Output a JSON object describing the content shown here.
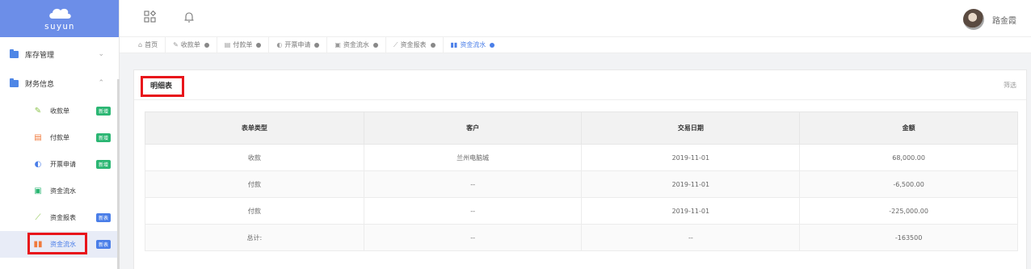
{
  "brand": "suyun",
  "sidebar": {
    "groups": [
      {
        "label": "库存管理",
        "expanded": false
      },
      {
        "label": "财务信息",
        "expanded": true
      }
    ],
    "items": [
      {
        "label": "收款单",
        "badge": "新增",
        "icon": "receipt-icon"
      },
      {
        "label": "付款单",
        "badge": "新增",
        "icon": "payment-icon"
      },
      {
        "label": "开票申请",
        "badge": "新增",
        "icon": "invoice-icon"
      },
      {
        "label": "资金流水",
        "badge": "",
        "icon": "cashflow-icon"
      },
      {
        "label": "资金报表",
        "badge": "新表",
        "icon": "line-chart-icon"
      },
      {
        "label": "资金流水",
        "badge": "新表",
        "icon": "bar-chart-icon"
      }
    ]
  },
  "user": {
    "name": "路金霞"
  },
  "tabs": [
    {
      "label": "首页",
      "icon": "home-icon"
    },
    {
      "label": "收款单",
      "icon": "receipt-icon"
    },
    {
      "label": "付款单",
      "icon": "payment-icon"
    },
    {
      "label": "开票申请",
      "icon": "invoice-icon"
    },
    {
      "label": "资金流水",
      "icon": "cashflow-icon"
    },
    {
      "label": "资金报表",
      "icon": "line-chart-icon"
    },
    {
      "label": "资金流水",
      "icon": "bar-chart-icon",
      "active": true
    }
  ],
  "card": {
    "title": "明细表",
    "filter": "筛选",
    "columns": [
      "表单类型",
      "客户",
      "交易日期",
      "金额"
    ],
    "rows": [
      [
        "收款",
        "兰州电脑城",
        "2019-11-01",
        "68,000.00"
      ],
      [
        "付款",
        "--",
        "2019-11-01",
        "-6,500.00"
      ],
      [
        "付款",
        "--",
        "2019-11-01",
        "-225,000.00"
      ],
      [
        "总计:",
        "--",
        "--",
        "-163500"
      ]
    ]
  },
  "colors": {
    "accent": "#4a7ee8",
    "logo_bg": "#6c8ee8",
    "highlight": "#e8151b"
  }
}
